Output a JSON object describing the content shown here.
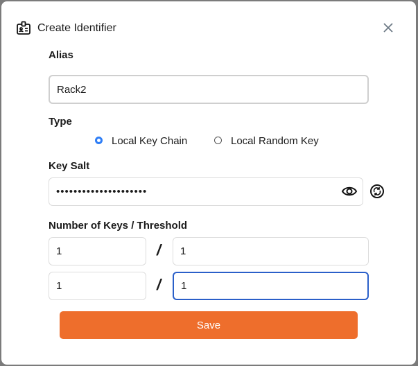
{
  "dialog": {
    "title": "Create Identifier",
    "icon": "id-badge-icon"
  },
  "alias": {
    "label": "Alias",
    "value": "Rack2"
  },
  "type": {
    "label": "Type",
    "options": [
      {
        "label": "Local Key Chain",
        "selected": true
      },
      {
        "label": "Local Random Key",
        "selected": false
      }
    ]
  },
  "key_salt": {
    "label": "Key Salt",
    "value": "•••••••••••••••••••••"
  },
  "keys": {
    "label": "Number of Keys / Threshold",
    "separator": "/",
    "rows": [
      {
        "keys": "1",
        "threshold": "1"
      },
      {
        "keys": "1",
        "threshold": "1"
      }
    ]
  },
  "save_label": "Save",
  "colors": {
    "accent": "#ee6e2c",
    "focus": "#2a5fc9",
    "radio": "#2f7ef6"
  }
}
